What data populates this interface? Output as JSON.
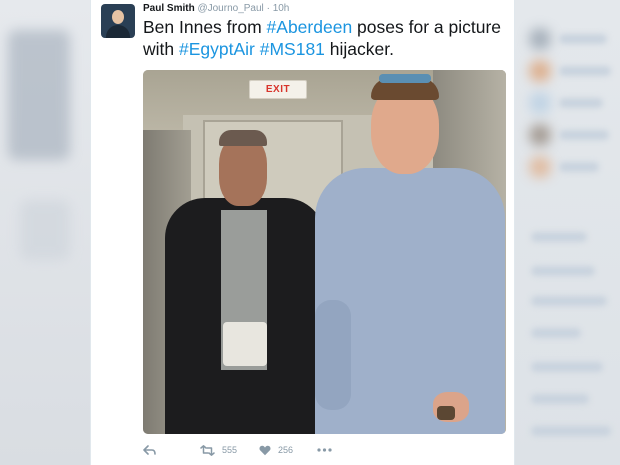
{
  "tweet": {
    "author_name": "Paul Smith",
    "author_handle": "@Journo_Paul",
    "separator": "·",
    "timestamp": "10h",
    "text_parts": [
      "Ben Innes from ",
      "#Aberdeen",
      " poses for a picture with ",
      "#EgyptAir",
      " ",
      "#MS181",
      " hijacker."
    ],
    "exit_sign": "EXIT",
    "retweet_count": "555",
    "like_count": "256"
  },
  "colors": {
    "hashtag": "#1b95e0",
    "text": "#14171a",
    "muted": "#8899a6",
    "exit_red": "#d8342b"
  },
  "icons": [
    "avatar",
    "reply-icon",
    "retweet-icon",
    "heart-icon",
    "more-icon"
  ]
}
